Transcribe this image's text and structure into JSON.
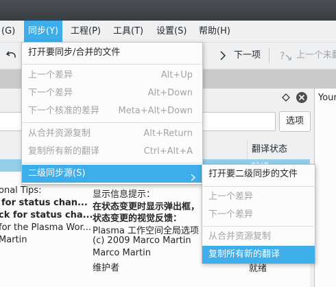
{
  "menubar": {
    "items": [
      {
        "label": "(G)"
      },
      {
        "label": "同步(Y)"
      },
      {
        "label": "工程(P)"
      },
      {
        "label": "工具(T)"
      },
      {
        "label": "设置(S)"
      },
      {
        "label": "帮助(H)"
      }
    ]
  },
  "toolbar": {
    "next_label": "下一项",
    "prev_untranslated_label": "上一个未翻"
  },
  "sync_menu": {
    "items": [
      {
        "label": "打开要同步/合并的文件",
        "shortcut": ""
      },
      {
        "label": "上一个差异",
        "shortcut": "Alt+Up"
      },
      {
        "label": "下一个差异",
        "shortcut": "Alt+Down"
      },
      {
        "label": "下一个核准的差异",
        "shortcut": "Meta+Alt+Down"
      },
      {
        "label": "从合并资源复制",
        "shortcut": "Alt+Return"
      },
      {
        "label": "复制所有新的翻译",
        "shortcut": "Ctrl+Alt+A"
      },
      {
        "label": "二级同步源(S)",
        "shortcut": ""
      }
    ]
  },
  "secondary_menu": {
    "items": [
      {
        "label": "打开要二级同步的文件"
      },
      {
        "label": "上一个差异"
      },
      {
        "label": "下一个差异"
      },
      {
        "label": "从合并资源复制"
      },
      {
        "label": "复制所有新的翻译"
      }
    ]
  },
  "filter": {
    "button_label": "选项"
  },
  "table": {
    "status_header": "翻译状态",
    "selected_status": "就绪"
  },
  "right_pane": {
    "label": "Your"
  },
  "content": {
    "left": [
      "onal Tips:",
      " for status chan...",
      "ck for status cha...",
      "for the Plasma Wor...",
      "Martin"
    ],
    "right": [
      "显示信息提示：",
      "在状态变更时显示弹出框，",
      "状态变更的视觉反馈：",
      "Plasma 工作空间全局选项",
      "(c) 2009 Marco Martin",
      "Marco Martin",
      "维护者"
    ],
    "status_last": "就绪"
  },
  "colors": {
    "accent": "#3daee9",
    "selection_row": "#93cee9"
  }
}
